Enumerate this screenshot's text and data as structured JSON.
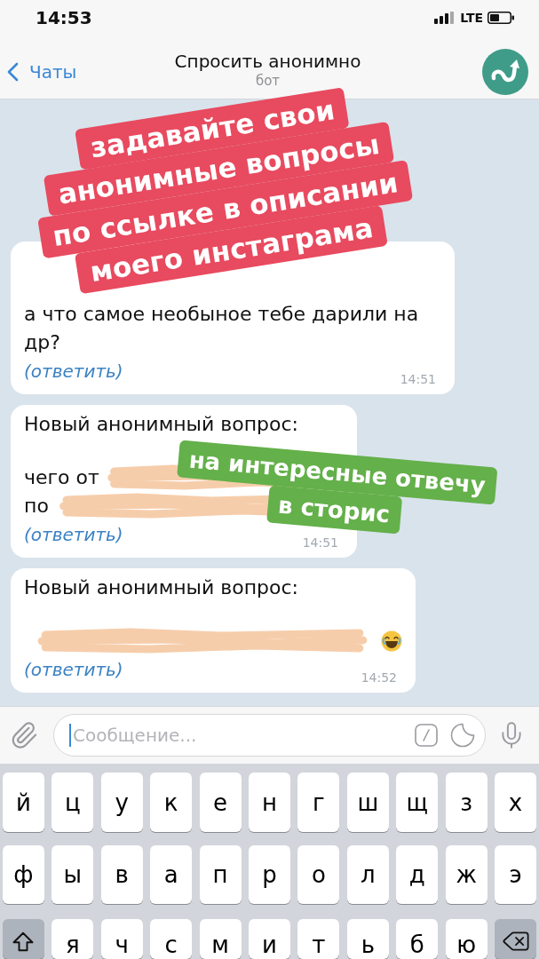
{
  "status_bar": {
    "time": "14:53",
    "network": "LTE"
  },
  "nav_bar": {
    "back_label": "Чаты",
    "title": "Спросить анонимно",
    "subtitle": "бот"
  },
  "messages": [
    {
      "lines": [
        {
          "text": "а что самое необыное тебе дарили на др?",
          "redacted": false,
          "trailing_emoji": false
        }
      ],
      "reply_link": "(ответить)",
      "time": "14:51"
    },
    {
      "header": "Новый анонимный вопрос:",
      "lines": [
        {
          "text": "чего от",
          "redacted": true,
          "trailing_emoji": false
        },
        {
          "text": "по",
          "redacted": true,
          "trailing_emoji": false
        }
      ],
      "reply_link": "(ответить)",
      "time": "14:51"
    },
    {
      "header": "Новый анонимный вопрос:",
      "lines": [
        {
          "redacted": true,
          "trailing_emoji": true
        }
      ],
      "reply_link": "(ответить)",
      "time": "14:52"
    }
  ],
  "stickers": [
    {
      "color": "#e84a5f",
      "lines": [
        "задавайте свои",
        "анонимные вопросы",
        "по ссылке в описании",
        "моего инстаграма"
      ]
    },
    {
      "color": "#64b04a",
      "lines": [
        "на интересные отвечу",
        "в сторис"
      ]
    }
  ],
  "composer": {
    "placeholder": "Сообщение..."
  },
  "keyboard": {
    "rows": [
      {
        "keys": [
          "й",
          "ц",
          "у",
          "к",
          "е",
          "н",
          "г",
          "ш",
          "щ",
          "з",
          "х"
        ],
        "modifiers": false
      },
      {
        "keys": [
          "ф",
          "ы",
          "в",
          "а",
          "п",
          "р",
          "о",
          "л",
          "д",
          "ж",
          "э"
        ],
        "modifiers": false
      },
      {
        "keys": [
          "я",
          "ч",
          "с",
          "м",
          "и",
          "т",
          "ь",
          "б",
          "ю"
        ],
        "modifiers": true
      }
    ]
  }
}
